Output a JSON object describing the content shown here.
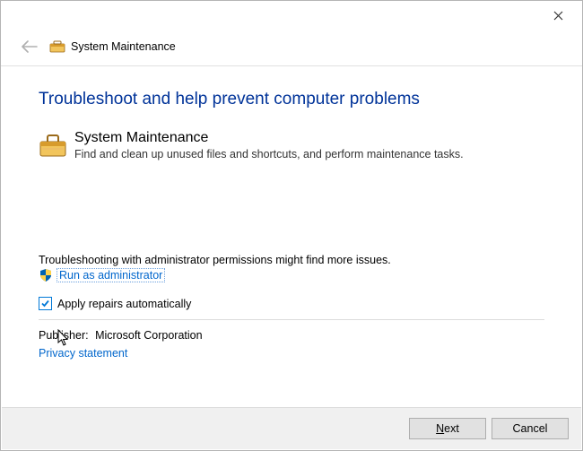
{
  "window": {
    "title": "System Maintenance"
  },
  "page": {
    "heading": "Troubleshoot and help prevent computer problems",
    "troubleshooter": {
      "name": "System Maintenance",
      "description": "Find and clean up unused files and shortcuts, and perform maintenance tasks."
    },
    "admin_note": "Troubleshooting with administrator permissions might find more issues.",
    "run_as_admin": "Run as administrator",
    "apply_repairs": {
      "label": "Apply repairs automatically",
      "checked": true
    },
    "publisher_label": "Publisher:",
    "publisher_value": "Microsoft Corporation",
    "privacy_link": "Privacy statement"
  },
  "footer": {
    "next": "Next",
    "cancel": "Cancel"
  }
}
